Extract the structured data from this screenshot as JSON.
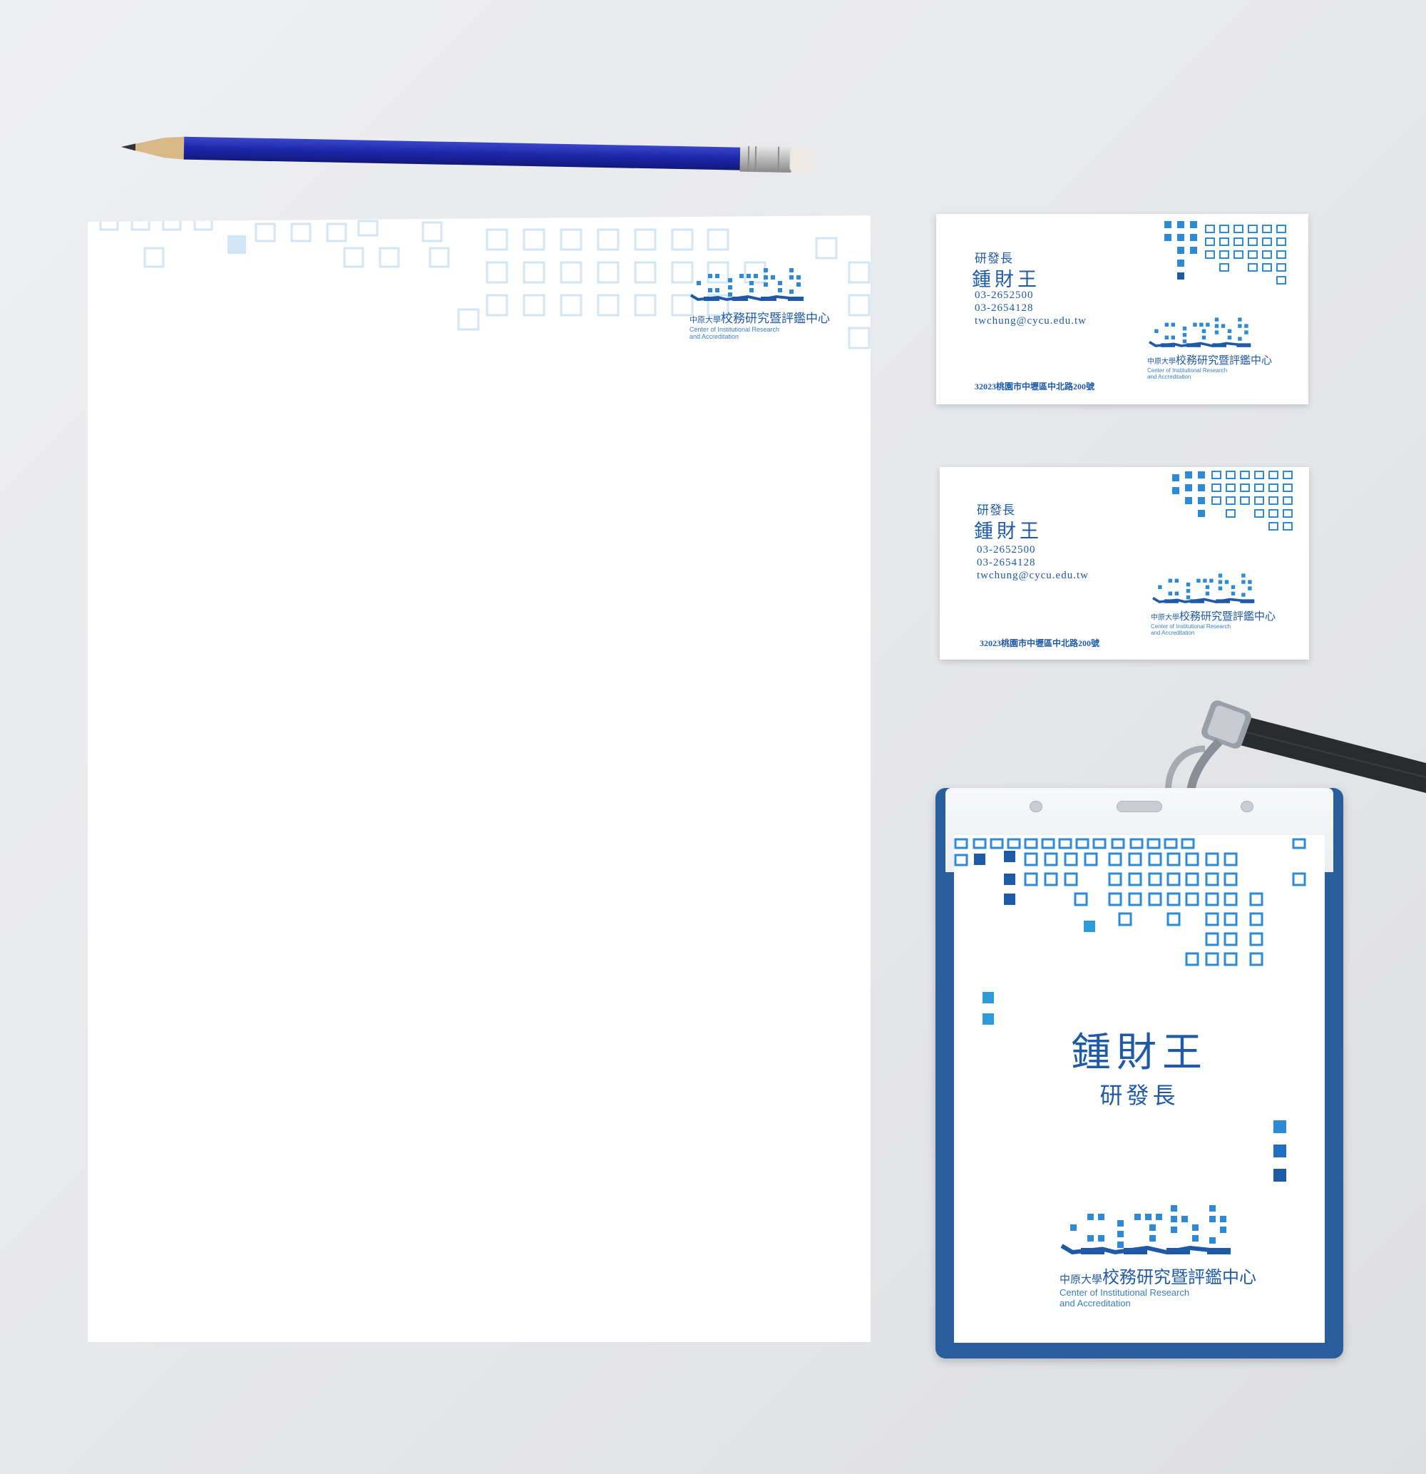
{
  "brand": {
    "name_zh_small": "中原大學",
    "name_zh_main": "校務研究暨評鑑中心",
    "name_en_line1": "Center of Institutional Research",
    "name_en_line2": "and Accreditation"
  },
  "card": {
    "title": "研發長",
    "name": "鍾財王",
    "phone1": "03-2652500",
    "phone2": "03-2654128",
    "email": "twchung@cycu.edu.tw",
    "address": "32023桃園市中壢區中北路200號"
  },
  "badge": {
    "name": "鍾財王",
    "title": "研發長"
  },
  "colors": {
    "primary": "#1f5aa6",
    "accent": "#2e8ad6",
    "light": "#cfe3f4",
    "badge_frame": "#2a5d9c"
  }
}
